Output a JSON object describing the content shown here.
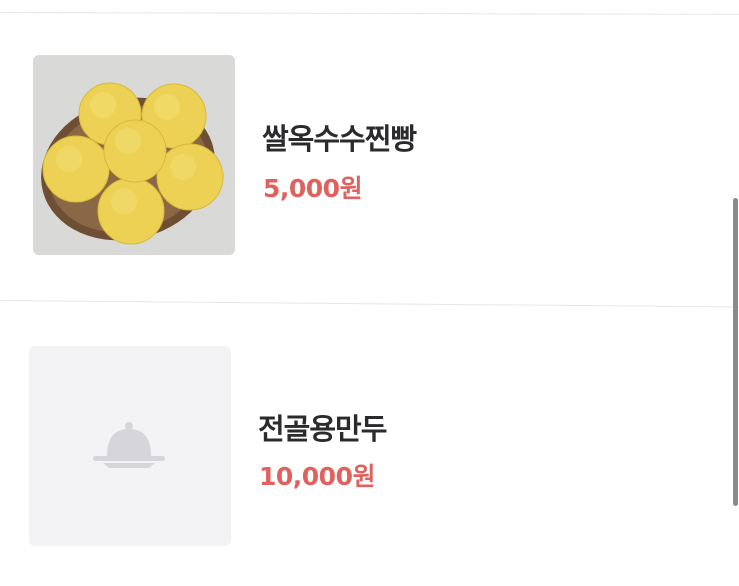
{
  "menu": {
    "items": [
      {
        "name": "쌀옥수수찐빵",
        "price": "5,000원",
        "image": "steamed-corn-buns-photo"
      },
      {
        "name": "전골용만두",
        "price": "10,000원",
        "image": "dish-placeholder-icon"
      }
    ]
  },
  "colors": {
    "price": "#e0625f",
    "name": "#2b2b2d",
    "placeholder_bg": "#f3f3f5",
    "placeholder_icon": "#d6d6da",
    "divider": "#e6e6e8",
    "scrollbar": "#8a8a8c"
  }
}
